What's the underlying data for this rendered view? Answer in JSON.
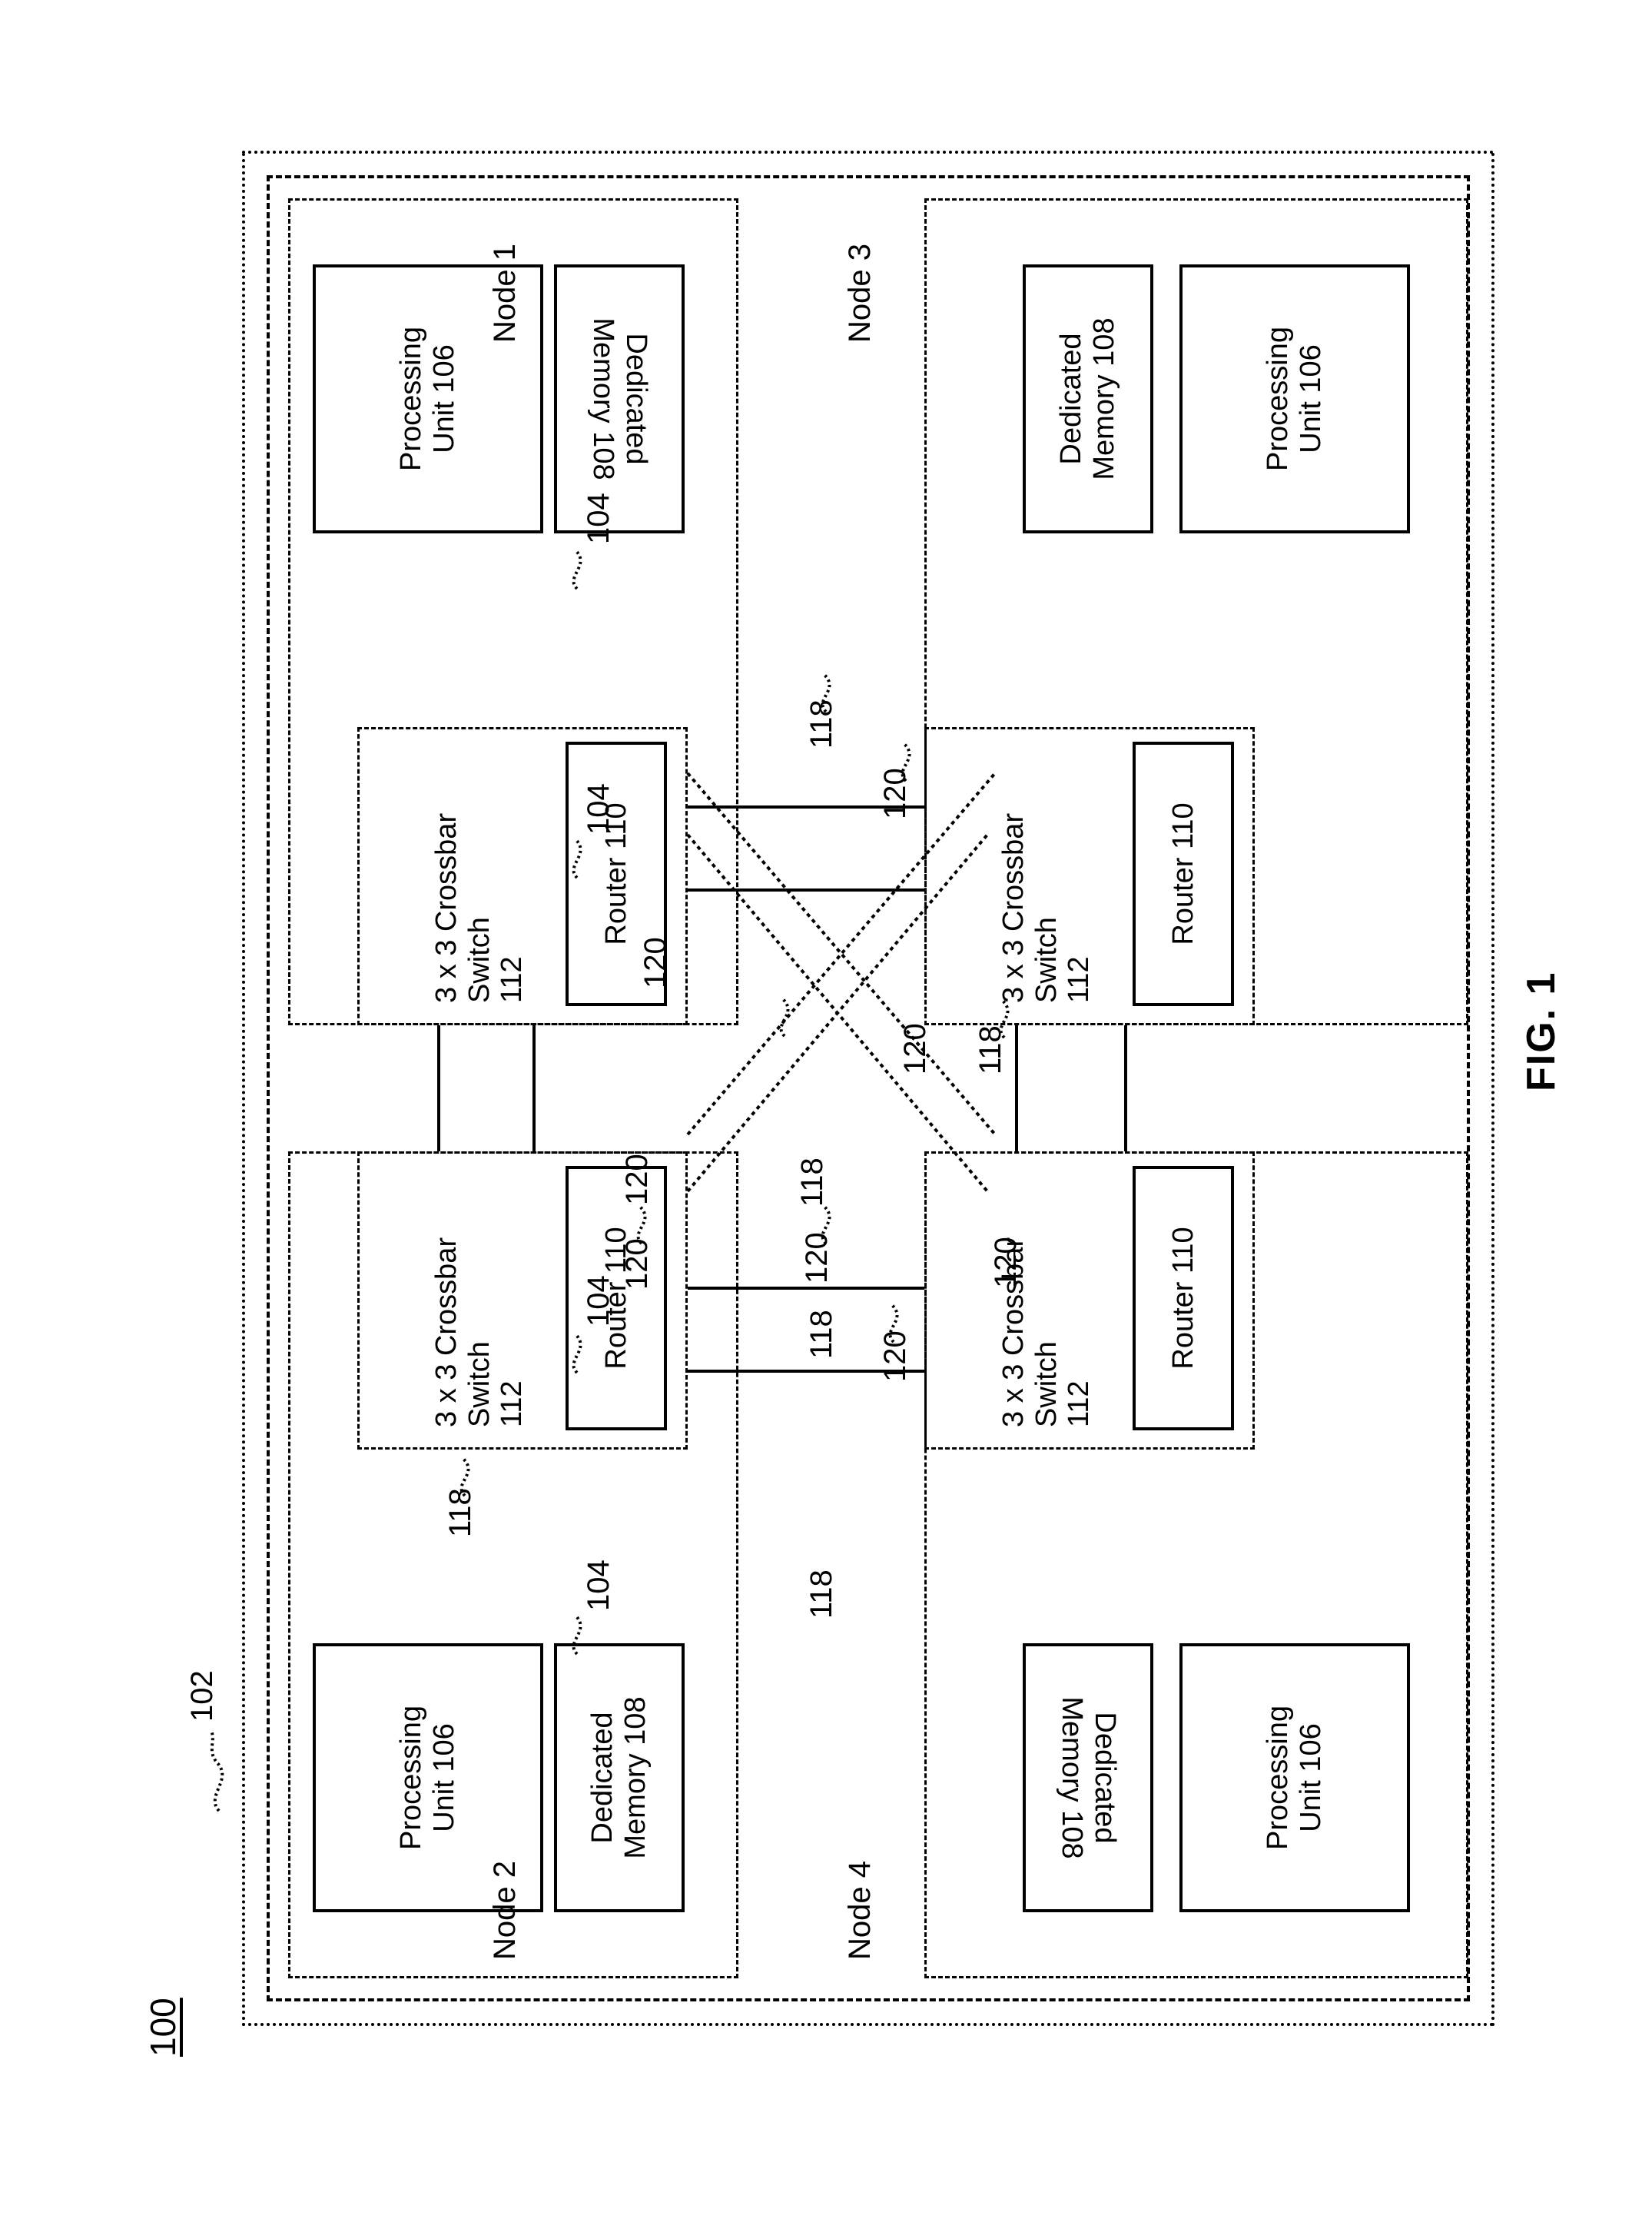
{
  "figure": {
    "caption": "FIG. 1",
    "system_ref": "100",
    "chip_ref": "102"
  },
  "refs": {
    "node_ref": "104",
    "processing_unit": "Processing\nUnit 106",
    "dedicated_memory": "Dedicated\nMemory 108",
    "router": "Router 110",
    "crossbar": "3 x 3 Crossbar\nSwitch\n112",
    "link_118": "118",
    "link_120": "120"
  },
  "nodes": [
    {
      "id": "node1",
      "label": "Node 1"
    },
    {
      "id": "node2",
      "label": "Node 2"
    },
    {
      "id": "node3",
      "label": "Node 3"
    },
    {
      "id": "node4",
      "label": "Node 4"
    }
  ],
  "callouts": {
    "n2_104": "104",
    "n1_104": "104",
    "n4_104": "104",
    "n3_104": "104",
    "n2_118_out": "118",
    "n2_120_out": "120",
    "n4_118_in": "118",
    "n4_120_in": "120",
    "n1_118_a": "118",
    "n1_118_b": "118",
    "n1_120_a": "120",
    "n1_120_b": "120",
    "n3_118": "118",
    "n3_120": "120",
    "c_118_a": "118",
    "c_118_b": "118",
    "c_120_a": "120",
    "c_120_b": "120",
    "c_120_c": "120",
    "c_120_d": "120"
  },
  "colors": {
    "ink": "#000000",
    "paper": "#ffffff"
  }
}
